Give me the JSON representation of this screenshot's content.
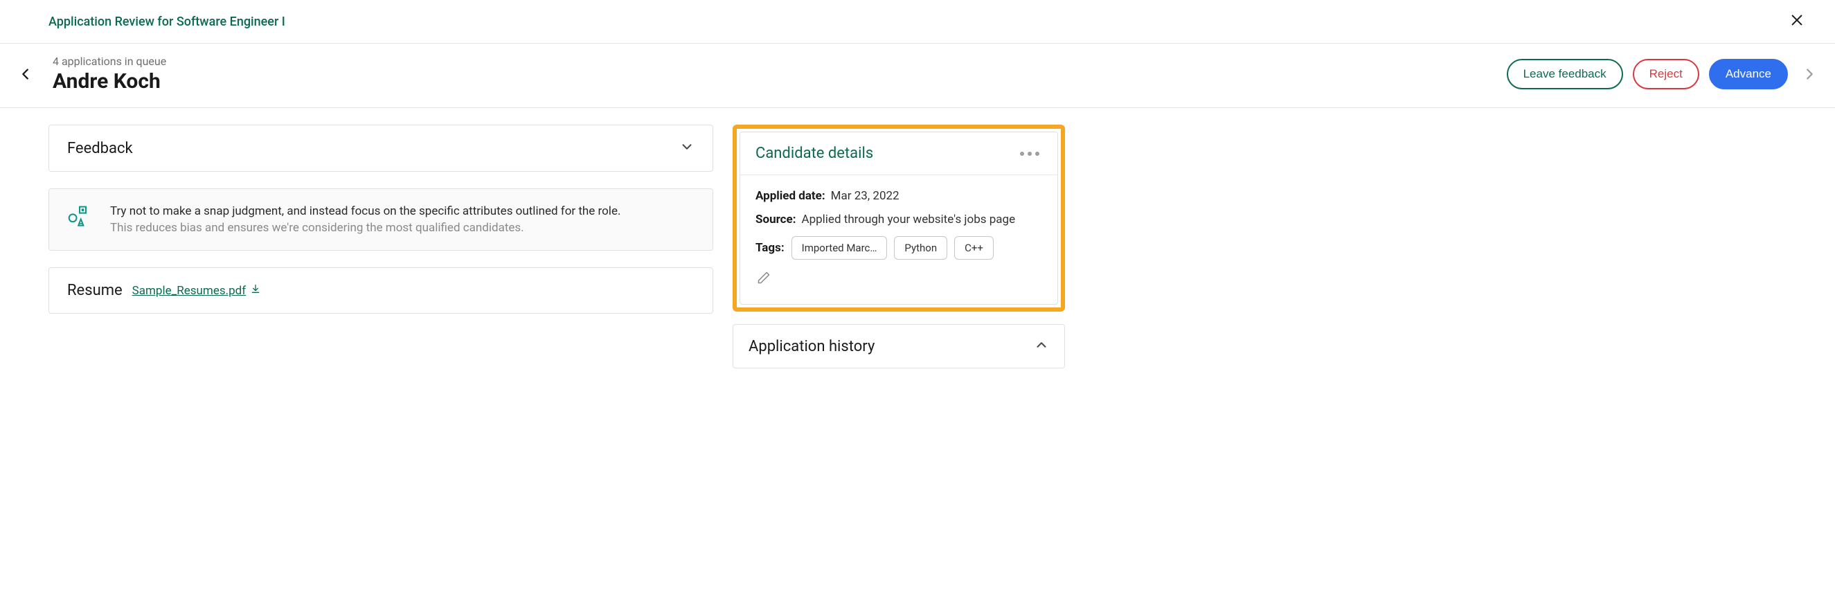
{
  "header": {
    "pageTitle": "Application Review for Software Engineer I",
    "queueText": "4 applications in queue",
    "candidateName": "Andre Koch",
    "leaveFeedback": "Leave feedback",
    "reject": "Reject",
    "advance": "Advance"
  },
  "feedback": {
    "title": "Feedback"
  },
  "tip": {
    "line1": "Try not to make a snap judgment, and instead focus on the specific attributes outlined for the role.",
    "line2": "This reduces bias and ensures we're considering the most qualified candidates."
  },
  "resume": {
    "title": "Resume",
    "filename": "Sample_Resumes.pdf"
  },
  "details": {
    "title": "Candidate details",
    "appliedDateLabel": "Applied date:",
    "appliedDate": "Mar 23, 2022",
    "sourceLabel": "Source:",
    "source": "Applied through your website's jobs page",
    "tagsLabel": "Tags:",
    "tags": [
      "Imported Marc…",
      "Python",
      "C++"
    ]
  },
  "history": {
    "title": "Application history"
  }
}
